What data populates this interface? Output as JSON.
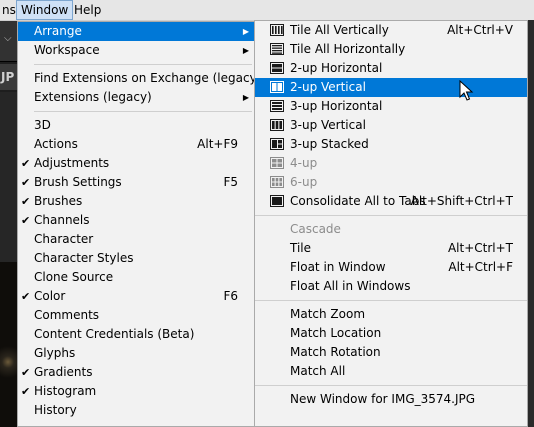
{
  "menubar": {
    "items": [
      "ns",
      "Window",
      "Help"
    ]
  },
  "background": {
    "tab_partial": "JP"
  },
  "window_menu": {
    "items": [
      {
        "label": "Arrange",
        "submenu": true,
        "highlight": true
      },
      {
        "label": "Workspace",
        "submenu": true
      },
      {
        "sep": true
      },
      {
        "label": "Find Extensions on Exchange (legacy)..."
      },
      {
        "label": "Extensions (legacy)",
        "submenu": true
      },
      {
        "sep": true
      },
      {
        "label": "3D"
      },
      {
        "label": "Actions",
        "shortcut": "Alt+F9"
      },
      {
        "label": "Adjustments",
        "checked": true
      },
      {
        "label": "Brush Settings",
        "checked": true,
        "shortcut": "F5"
      },
      {
        "label": "Brushes",
        "checked": true
      },
      {
        "label": "Channels",
        "checked": true
      },
      {
        "label": "Character"
      },
      {
        "label": "Character Styles"
      },
      {
        "label": "Clone Source"
      },
      {
        "label": "Color",
        "checked": true,
        "shortcut": "F6"
      },
      {
        "label": "Comments"
      },
      {
        "label": "Content Credentials (Beta)"
      },
      {
        "label": "Glyphs"
      },
      {
        "label": "Gradients",
        "checked": true
      },
      {
        "label": "Histogram",
        "checked": true
      },
      {
        "label": "History"
      }
    ]
  },
  "arrange_menu": {
    "items": [
      {
        "label": "Tile All Vertically",
        "shortcut": "Alt+Ctrl+V",
        "icon": "tile-vertical-icon"
      },
      {
        "label": "Tile All Horizontally",
        "icon": "tile-horizontal-icon"
      },
      {
        "label": "2-up Horizontal",
        "icon": "2up-horizontal-icon"
      },
      {
        "label": "2-up Vertical",
        "icon": "2up-vertical-icon",
        "highlight": true
      },
      {
        "label": "3-up Horizontal",
        "icon": "3up-horizontal-icon"
      },
      {
        "label": "3-up Vertical",
        "icon": "3up-vertical-icon"
      },
      {
        "label": "3-up Stacked",
        "icon": "3up-stacked-icon"
      },
      {
        "label": "4-up",
        "icon": "4up-icon",
        "disabled": true
      },
      {
        "label": "6-up",
        "icon": "6up-icon",
        "disabled": true
      },
      {
        "label": "Consolidate All to Tabs",
        "shortcut": "Alt+Shift+Ctrl+T",
        "icon": "consolidate-tabs-icon"
      },
      {
        "sep": true
      },
      {
        "label": "Cascade",
        "disabled": true
      },
      {
        "label": "Tile",
        "shortcut": "Alt+Ctrl+T"
      },
      {
        "label": "Float in Window",
        "shortcut": "Alt+Ctrl+F"
      },
      {
        "label": "Float All in Windows"
      },
      {
        "sep": true
      },
      {
        "label": "Match Zoom"
      },
      {
        "label": "Match Location"
      },
      {
        "label": "Match Rotation"
      },
      {
        "label": "Match All"
      },
      {
        "sep": true
      },
      {
        "label": "New Window for IMG_3574.JPG"
      }
    ]
  },
  "colors": {
    "highlight": "#0078d7",
    "menu_bg": "#f2f2f2",
    "disabled": "#8c8c8c"
  }
}
